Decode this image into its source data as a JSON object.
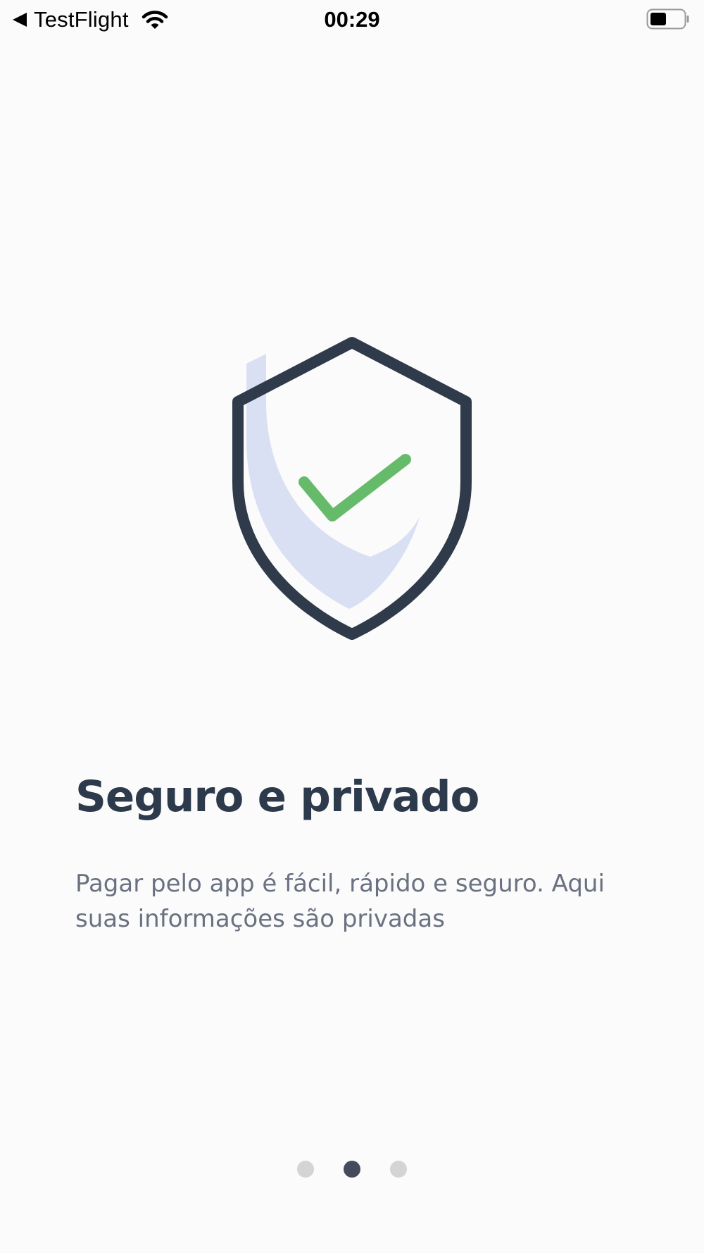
{
  "status_bar": {
    "back_label": "TestFlight",
    "time": "00:29",
    "icons": [
      "back-arrow-icon",
      "wifi-icon",
      "battery-icon"
    ]
  },
  "onboarding": {
    "illustration": "shield-check-icon",
    "title": "Seguro e privado",
    "description": "Pagar pelo app é fácil, rápido e seguro. Aqui suas informações são privadas",
    "pager": {
      "total": 3,
      "current_index": 1
    }
  },
  "colors": {
    "background": "#fbfbfc",
    "title": "#2d3a4b",
    "description": "#6a7180",
    "shield_outline": "#2f3b4a",
    "shield_fill": "#d9e0f3",
    "check": "#66bb6a",
    "dot_active": "#454b5a",
    "dot_inactive": "#d4d4d7"
  }
}
